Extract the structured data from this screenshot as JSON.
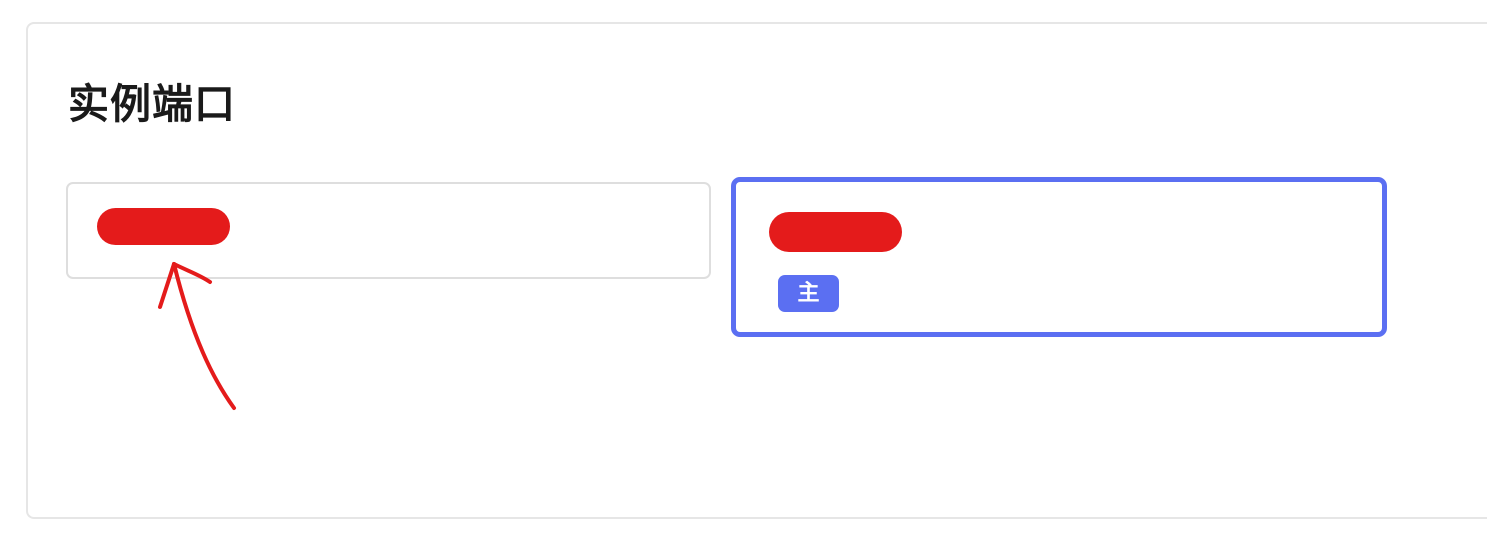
{
  "section": {
    "title": "实例端口"
  },
  "ports": [
    {
      "value": "",
      "selected": false,
      "redacted": true
    },
    {
      "value": "",
      "selected": true,
      "redacted": true,
      "badge": "主"
    }
  ],
  "colors": {
    "accent": "#5b6ff2",
    "border": "#dedede",
    "redaction": "#e41b1b"
  },
  "annotation": {
    "type": "hand-drawn-arrow",
    "color": "#e41b1b"
  }
}
